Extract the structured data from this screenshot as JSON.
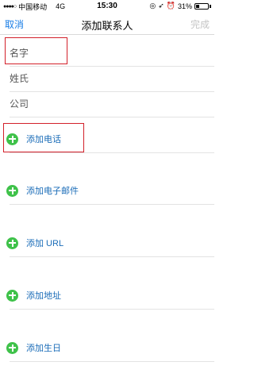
{
  "status": {
    "carrier": "中国移动",
    "network": "4G",
    "time": "15:30",
    "battery": "31%",
    "battery_level": 0.31
  },
  "nav": {
    "cancel": "取消",
    "title": "添加联系人",
    "done": "完成"
  },
  "fields": {
    "first_name": "名字",
    "last_name": "姓氏",
    "company": "公司"
  },
  "add_items": {
    "phone": "添加电话",
    "email": "添加电子邮件",
    "url": "添加 URL",
    "address": "添加地址",
    "birthday": "添加生日"
  },
  "colors": {
    "accent": "#1a7ee6",
    "plus": "#3fc24a",
    "highlight": "#d3202a"
  }
}
